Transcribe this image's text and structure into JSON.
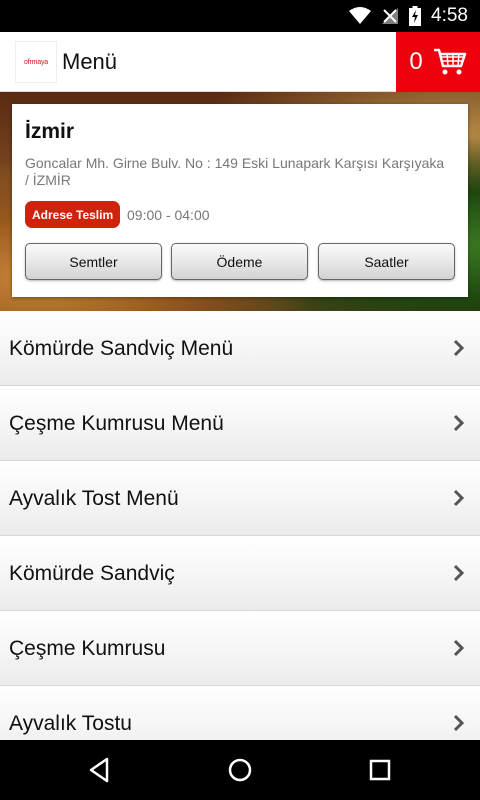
{
  "status_bar": {
    "time": "4:58",
    "icons": [
      "wifi-icon",
      "no-signal-icon",
      "battery-charging-icon"
    ]
  },
  "app_bar": {
    "logo_text": "ofrmaya",
    "title": "Menü",
    "cart_count": "0",
    "cart_icon": "cart-icon"
  },
  "colors": {
    "accent": "#f0000c",
    "badge": "#d0230e"
  },
  "restaurant": {
    "city": "İzmir",
    "address": "Goncalar Mh. Girne Bulv.  No : 149 Eski Lunapark Karşısı Karşıyaka / İZMİR",
    "badge": "Adrese Teslim",
    "hours": "09:00 - 04:00",
    "buttons": [
      "Semtler",
      "Ödeme",
      "Saatler"
    ]
  },
  "menu": {
    "items": [
      "Kömürde Sandviç Menü",
      "Çeşme Kumrusu Menü",
      "Ayvalık Tost Menü",
      "Kömürde Sandviç",
      "Çeşme Kumrusu",
      "Ayvalık Tostu"
    ]
  },
  "nav": {
    "icons": [
      "back-icon",
      "home-icon",
      "recents-icon"
    ]
  }
}
